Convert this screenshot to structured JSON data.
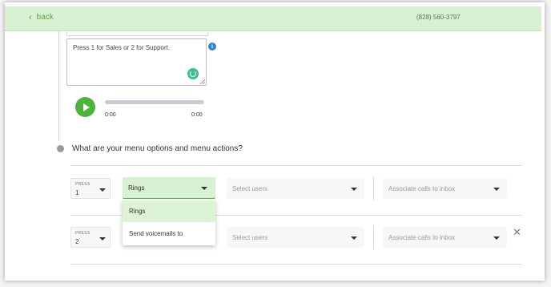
{
  "topbar": {
    "back_label": "back",
    "phone": "(828) 560-3797"
  },
  "message": {
    "text": "Press 1 for Sales or 2 for Support."
  },
  "audio": {
    "current_time": "0:00",
    "duration": "0:00"
  },
  "menu": {
    "question": "What are your menu options and menu actions?",
    "rows": [
      {
        "press_label": "PRESS",
        "press_value": "1",
        "action": "Rings",
        "users_placeholder": "Select users",
        "inbox_placeholder": "Associate calls to inbox"
      },
      {
        "press_label": "PRESS",
        "press_value": "2",
        "action": "",
        "users_placeholder": "Select users",
        "inbox_placeholder": "Associate calls to inbox"
      }
    ],
    "dropdown_options": [
      "Rings",
      "Send voicemails to"
    ]
  },
  "colors": {
    "accent_green": "#4cb43a",
    "topbar_bg": "#d9f1d3",
    "info_blue": "#2f87c8"
  },
  "icons": {
    "back": "chevron-left-icon",
    "info": "info-icon",
    "spinner": "loading-icon",
    "play": "play-icon",
    "remove": "close-icon"
  }
}
